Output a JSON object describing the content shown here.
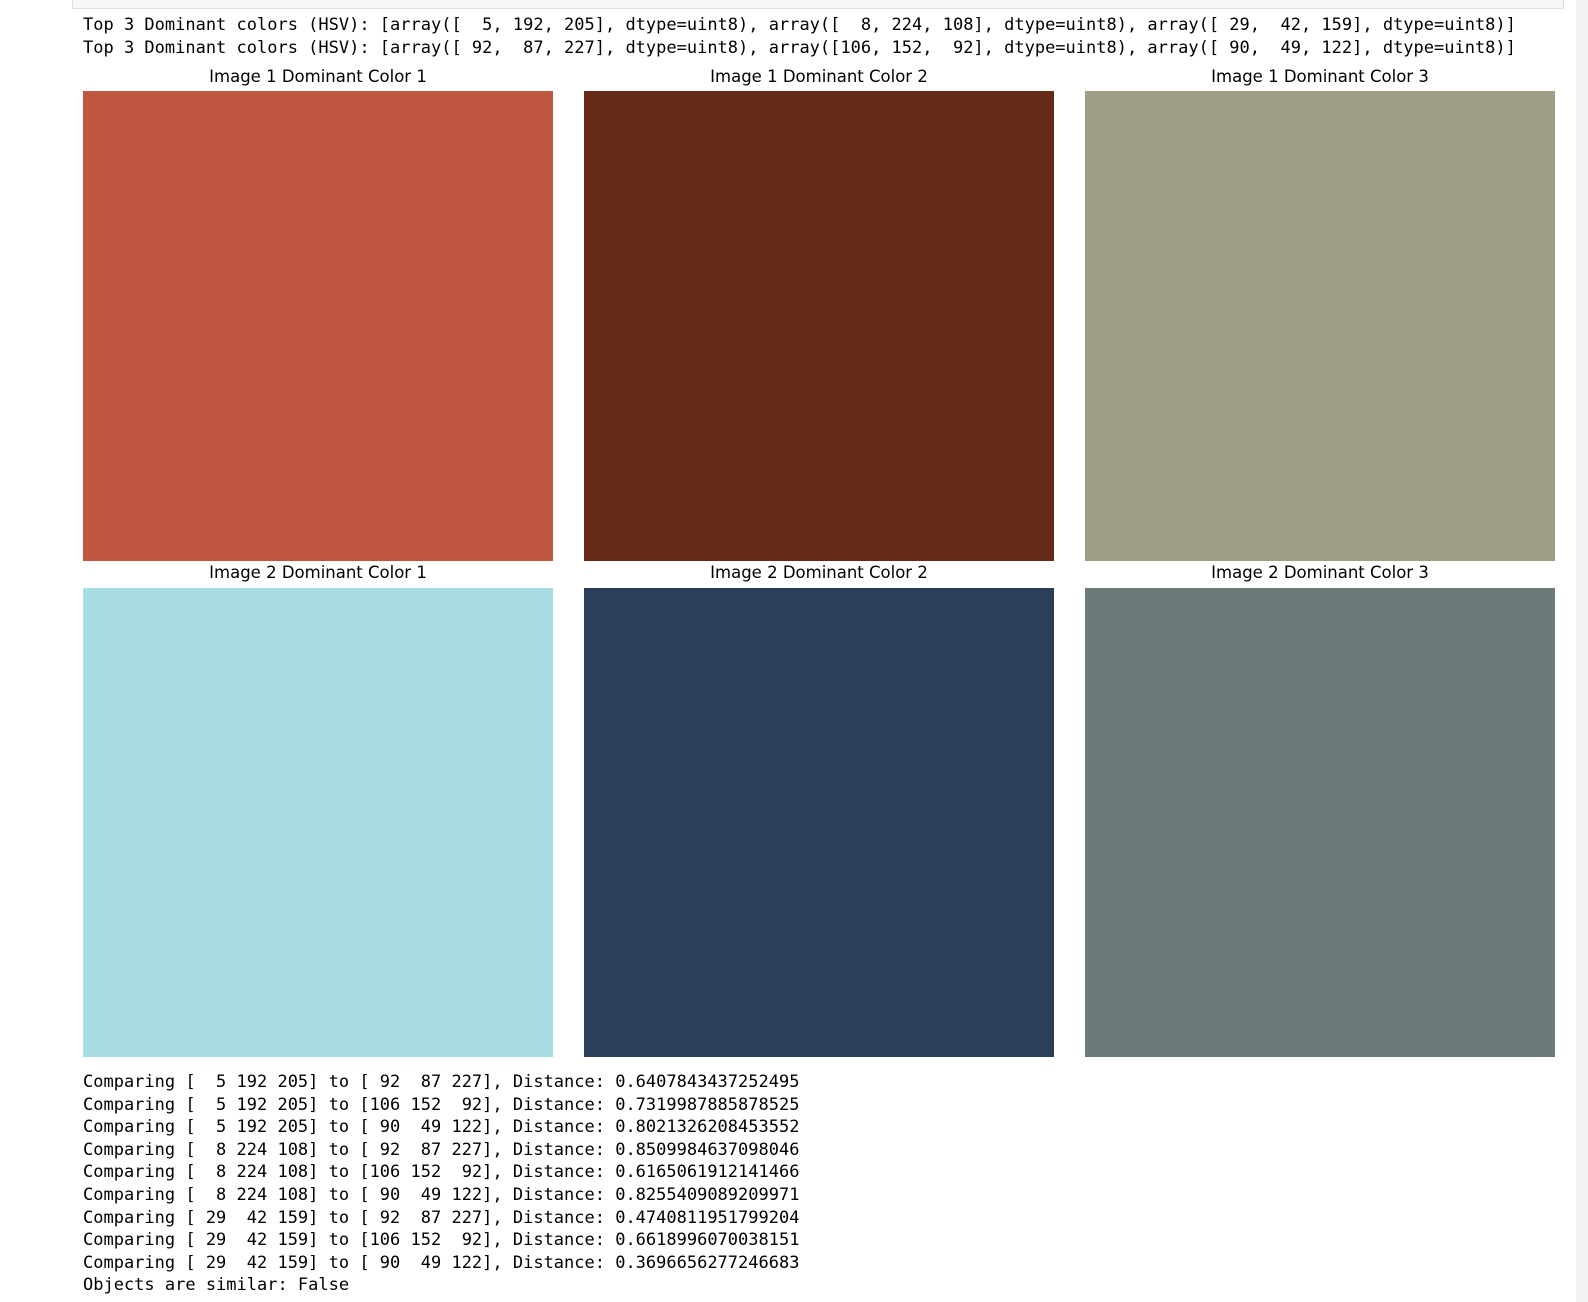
{
  "output": {
    "dominant_lines": [
      "Top 3 Dominant colors (HSV): [array([  5, 192, 205], dtype=uint8), array([  8, 224, 108], dtype=uint8), array([ 29,  42, 159], dtype=uint8)]",
      "Top 3 Dominant colors (HSV): [array([ 92,  87, 227], dtype=uint8), array([106, 152,  92], dtype=uint8), array([ 90,  49, 122], dtype=uint8)]"
    ],
    "comparison_lines": [
      "Comparing [  5 192 205] to [ 92  87 227], Distance: 0.6407843437252495",
      "Comparing [  5 192 205] to [106 152  92], Distance: 0.7319987885878525",
      "Comparing [  5 192 205] to [ 90  49 122], Distance: 0.8021326208453552",
      "Comparing [  8 224 108] to [ 92  87 227], Distance: 0.8509984637098046",
      "Comparing [  8 224 108] to [106 152  92], Distance: 0.6165061912141466",
      "Comparing [  8 224 108] to [ 90  49 122], Distance: 0.8255409089209971",
      "Comparing [ 29  42 159] to [ 92  87 227], Distance: 0.4740811951799204",
      "Comparing [ 29  42 159] to [106 152  92], Distance: 0.6618996070038151",
      "Comparing [ 29  42 159] to [ 90  49 122], Distance: 0.3696656277246683",
      "Objects are similar: False"
    ]
  },
  "figure": {
    "panels": [
      {
        "title": "Image 1 Dominant Color 1",
        "color": "#BF5640"
      },
      {
        "title": "Image 1 Dominant Color 2",
        "color": "#652B17"
      },
      {
        "title": "Image 1 Dominant Color 3",
        "color": "#9F9F86"
      },
      {
        "title": "Image 2 Dominant Color 1",
        "color": "#A7DCE2"
      },
      {
        "title": "Image 2 Dominant Color 2",
        "color": "#2B3E5A"
      },
      {
        "title": "Image 2 Dominant Color 3",
        "color": "#6A7A79"
      }
    ]
  }
}
